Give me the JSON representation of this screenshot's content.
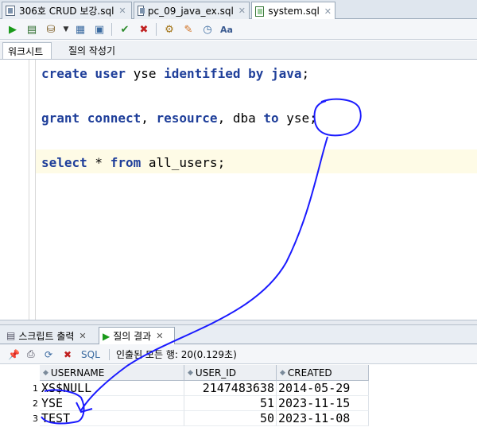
{
  "file_tabs": [
    {
      "label": "306호 CRUD 보강.sql",
      "icon": "worksheet-icon"
    },
    {
      "label": "pc_09_java_ex.sql",
      "icon": "worksheet-icon"
    },
    {
      "label": "system.sql",
      "icon": "sql-worksheet-icon"
    }
  ],
  "toolbar": {
    "icons": [
      "run-statement-icon",
      "run-script-icon",
      "commit-icon",
      "dropdown-icon",
      "explain-plan-icon",
      "autotrace-icon",
      "commit-changes-icon",
      "rollback-icon",
      "sql-tuning-icon",
      "eraser-icon",
      "history-icon",
      "format-icon"
    ]
  },
  "sub_tabs": [
    "워크시트",
    "질의 작성기"
  ],
  "editor": {
    "lines": [
      {
        "kw1": "create user",
        "t1": " yse ",
        "kw2": "identified by java",
        "t2": ";"
      },
      {
        "kw1": "grant connect",
        "t1": ", ",
        "kw2": "resource",
        "t2": ", dba ",
        "kw3": "to",
        "t3": " yse;"
      },
      {
        "kw1": "select",
        "t1": " * ",
        "kw2": "from",
        "t2": " all_users;"
      }
    ]
  },
  "result_tabs": [
    "스크립트 출력",
    "질의 결과"
  ],
  "result_toolbar": {
    "sql_label": "SQL",
    "status": "인출된 모든 행: 20(0.129초)"
  },
  "grid": {
    "columns": [
      "USERNAME",
      "USER_ID",
      "CREATED"
    ],
    "rows": [
      {
        "num": "1",
        "username": "XS$NULL",
        "user_id": "2147483638",
        "created": "2014-05-29"
      },
      {
        "num": "2",
        "username": "YSE",
        "user_id": "51",
        "created": "2023-11-15"
      },
      {
        "num": "3",
        "username": "TEST",
        "user_id": "50",
        "created": "2023-11-08"
      }
    ]
  },
  "colors": {
    "keyword": "#1f3f9a",
    "annotation": "#1a1aff",
    "current_line": "#fefbe6"
  }
}
